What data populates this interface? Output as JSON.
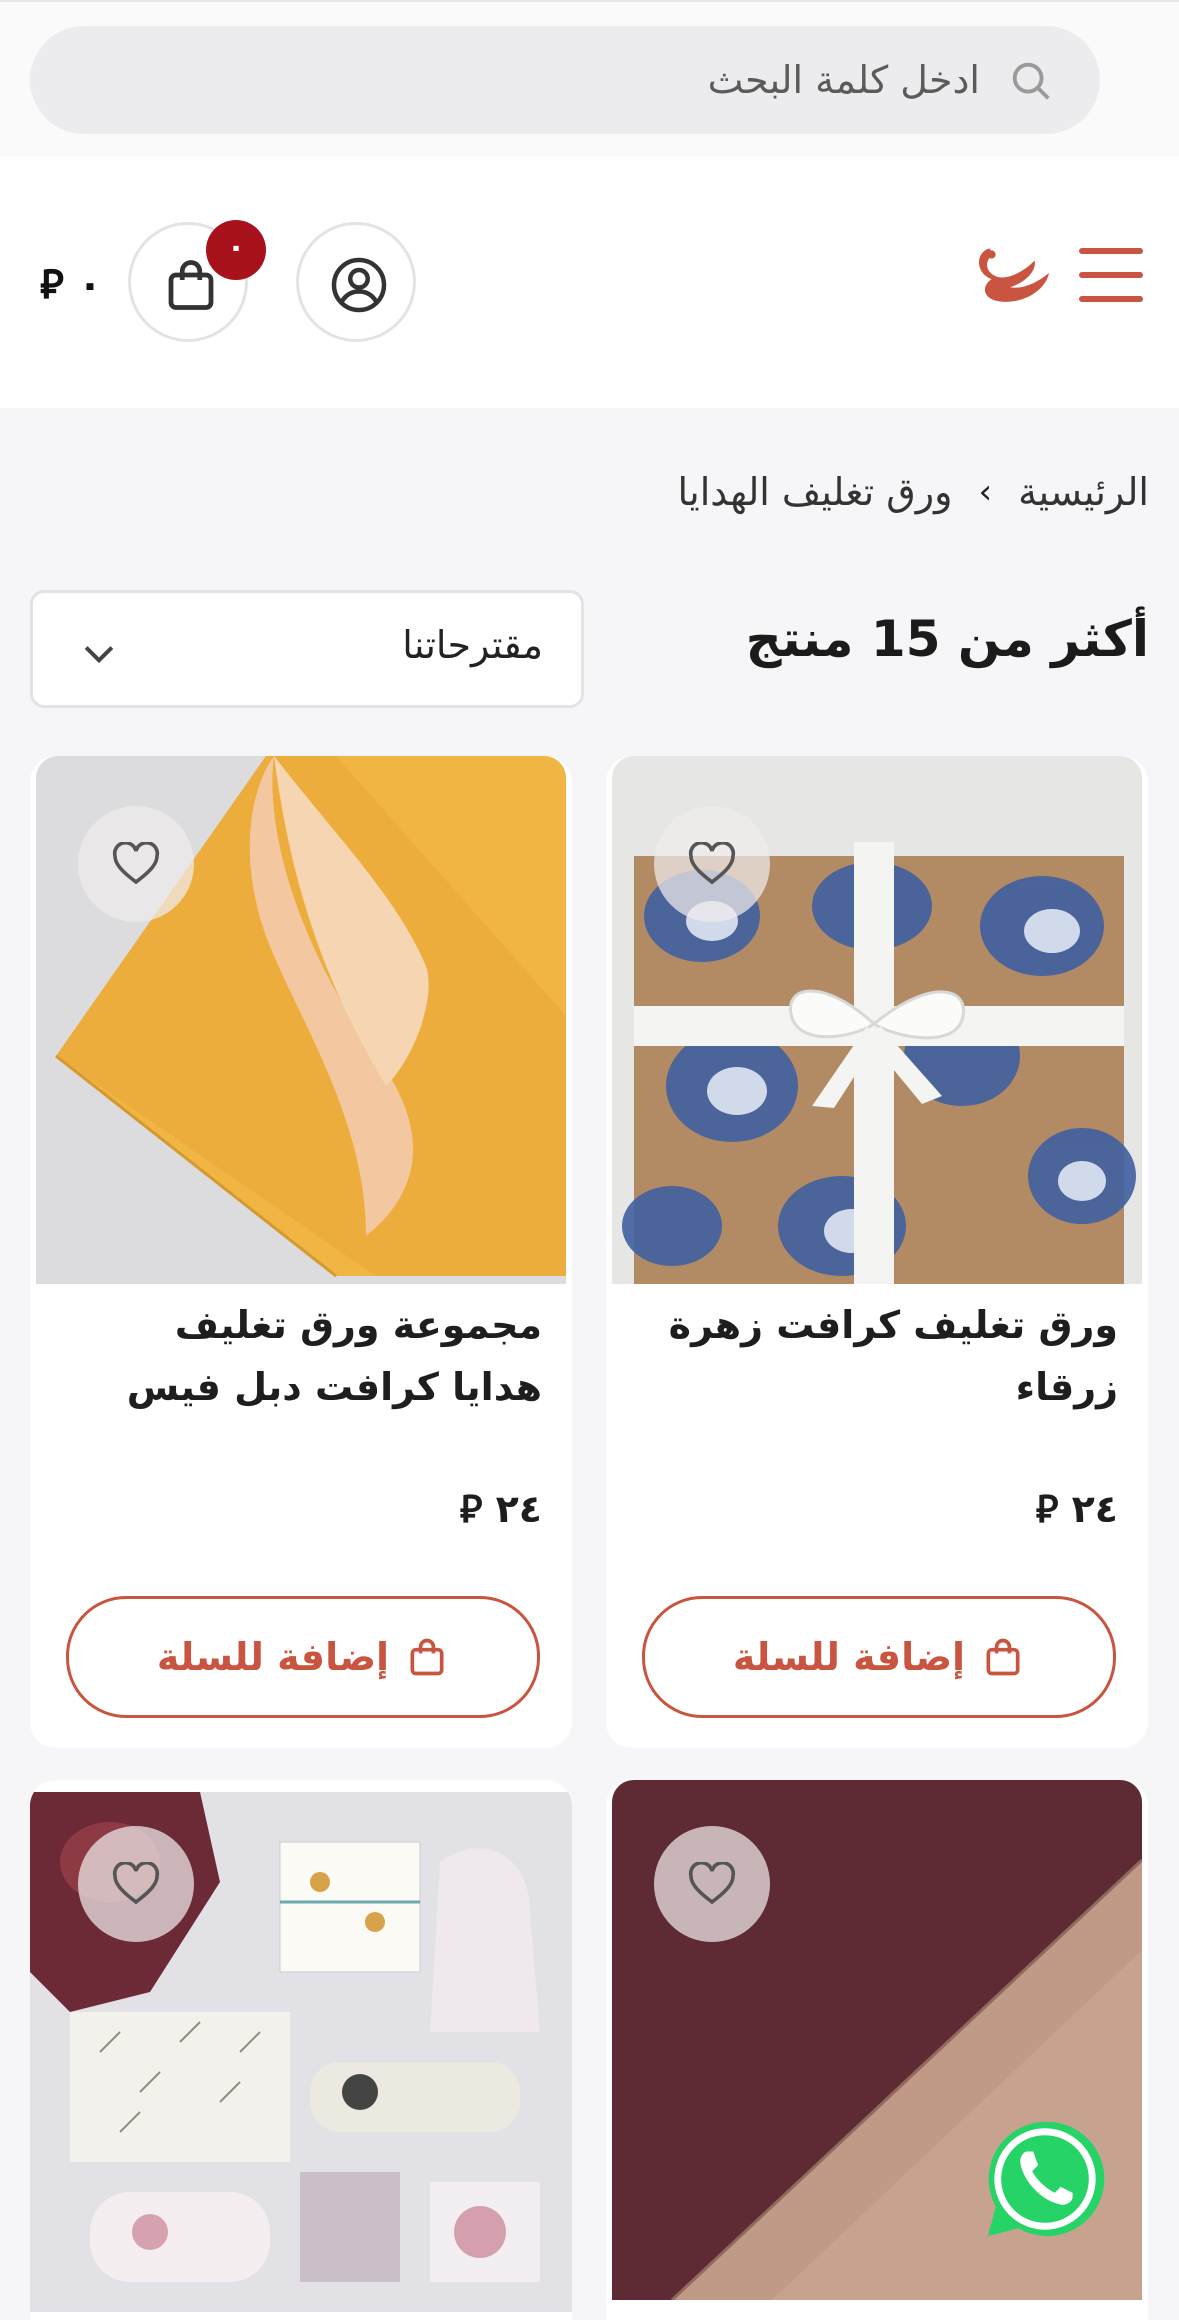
{
  "search": {
    "placeholder": "ادخل كلمة البحث"
  },
  "header": {
    "cart_badge": "٠",
    "cart_total": "٠ ⃁"
  },
  "breadcrumb": {
    "home": "الرئيسية",
    "separator": "›",
    "current": "ورق تغليف الهدايا"
  },
  "listing": {
    "count_title": "أكثر من 15 منتج",
    "sort_selected": "مقترحاتنا"
  },
  "products": [
    {
      "name": "ورق تغليف كرافت زهرة زرقاء",
      "price": "٢٤ ⃁",
      "add_label": "إضافة للسلة"
    },
    {
      "name": "مجموعة ورق تغليف هدايا كرافت دبل فيس",
      "price": "٢٤ ⃁",
      "add_label": "إضافة للسلة"
    }
  ],
  "colors": {
    "accent": "#c9543f",
    "badge": "#a8121c",
    "background": "#f6f6f8",
    "whatsapp": "#25d366"
  },
  "icons": [
    "search-icon",
    "menu-icon",
    "logo-icon",
    "user-icon",
    "bag-icon",
    "chevron-down-icon",
    "heart-icon",
    "whatsapp-icon"
  ]
}
